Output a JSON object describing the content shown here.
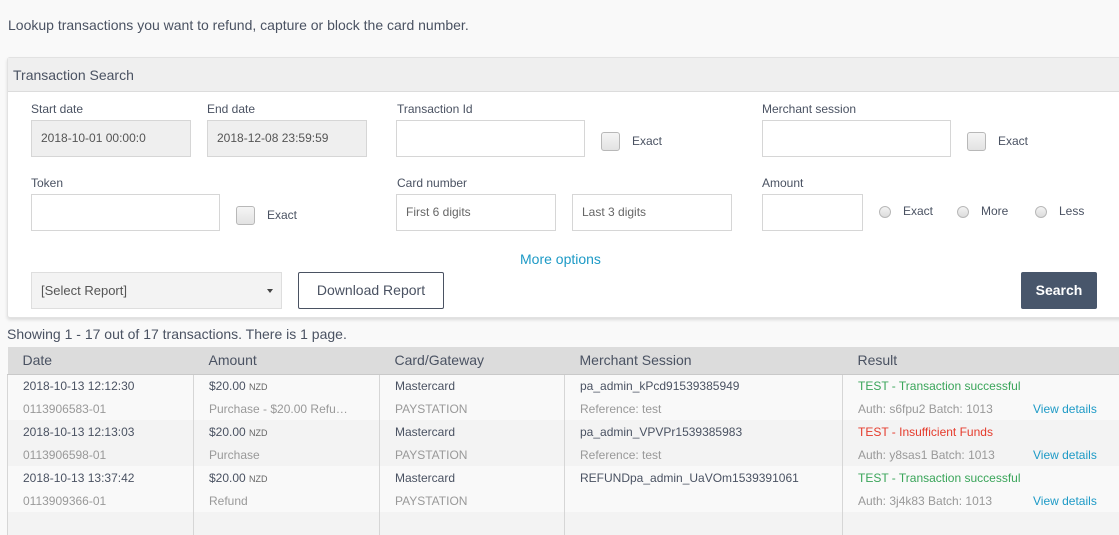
{
  "intro": "Lookup transactions you want to refund, capture or block the card number.",
  "panel": {
    "title": "Transaction Search",
    "start_date": {
      "label": "Start date",
      "value": "2018-10-01 00:00:0"
    },
    "end_date": {
      "label": "End date",
      "value": "2018-12-08 23:59:59"
    },
    "transaction_id": {
      "label": "Transaction Id",
      "value": "",
      "exact_label": "Exact"
    },
    "merchant_session": {
      "label": "Merchant session",
      "value": "",
      "exact_label": "Exact"
    },
    "token": {
      "label": "Token",
      "value": "",
      "exact_label": "Exact"
    },
    "card_number": {
      "label": "Card number",
      "first_placeholder": "First 6 digits",
      "last_placeholder": "Last 3 digits"
    },
    "amount": {
      "label": "Amount",
      "value": "",
      "options": [
        "Exact",
        "More",
        "Less"
      ]
    },
    "more_options": "More options",
    "report_select": "[Select Report]",
    "download_label": "Download Report",
    "search_label": "Search"
  },
  "results": {
    "summary": "Showing 1 - 17 out of 17 transactions. There is 1 page.",
    "columns": [
      "Date",
      "Amount",
      "Card/Gateway",
      "Merchant Session",
      "Result"
    ],
    "view_label": "View details",
    "rows": [
      {
        "date": "2018-10-13 12:12:30",
        "txn": "0113906583-01",
        "amount": "$20.00",
        "currency": "NZD",
        "type": "Purchase - $20.00 Refu…",
        "card": "Mastercard",
        "gateway": "PAYSTATION",
        "session": "pa_admin_kPcd91539385949",
        "reference": "Reference: test",
        "result": "TEST - Transaction successful",
        "status": "success",
        "auth": "Auth: s6fpu2 Batch: 1013"
      },
      {
        "date": "2018-10-13 12:13:03",
        "txn": "0113906598-01",
        "amount": "$20.00",
        "currency": "NZD",
        "type": "Purchase",
        "card": "Mastercard",
        "gateway": "PAYSTATION",
        "session": "pa_admin_VPVPr1539385983",
        "reference": "Reference: test",
        "result": "TEST - Insufficient Funds",
        "status": "error",
        "auth": "Auth: y8sas1 Batch: 1013"
      },
      {
        "date": "2018-10-13 13:37:42",
        "txn": "0113909366-01",
        "amount": "$20.00",
        "currency": "NZD",
        "type": "Refund",
        "card": "Mastercard",
        "gateway": "PAYSTATION",
        "session": "REFUNDpa_admin_UaVOm1539391061",
        "reference": "",
        "result": "TEST - Transaction successful",
        "status": "success",
        "auth": "Auth: 3j4k83 Batch: 1013"
      }
    ]
  }
}
